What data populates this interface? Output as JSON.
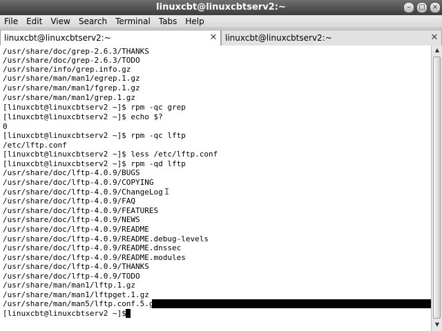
{
  "window": {
    "title": "linuxcbt@linuxcbtserv2:~",
    "minimize_glyph": "–",
    "maximize_glyph": "□",
    "close_glyph": "×"
  },
  "menu": [
    "File",
    "Edit",
    "View",
    "Search",
    "Terminal",
    "Tabs",
    "Help"
  ],
  "tabs": [
    {
      "label": "linuxcbt@linuxcbtserv2:~",
      "active": true,
      "close_icon": "close-icon"
    },
    {
      "label": "linuxcbt@linuxcbtserv2:~",
      "active": false,
      "close_icon": "close-icon"
    }
  ],
  "terminal": {
    "lines": [
      "/usr/share/doc/grep-2.6.3/THANKS",
      "/usr/share/doc/grep-2.6.3/TODO",
      "/usr/share/info/grep.info.gz",
      "/usr/share/man/man1/egrep.1.gz",
      "/usr/share/man/man1/fgrep.1.gz",
      "/usr/share/man/man1/grep.1.gz",
      "[linuxcbt@linuxcbtserv2 ~]$ rpm -qc grep",
      "[linuxcbt@linuxcbtserv2 ~]$ echo $?",
      "0",
      "[linuxcbt@linuxcbtserv2 ~]$ rpm -qc lftp",
      "/etc/lftp.conf",
      "[linuxcbt@linuxcbtserv2 ~]$ less /etc/lftp.conf",
      "[linuxcbt@linuxcbtserv2 ~]$ rpm -qd lftp",
      "/usr/share/doc/lftp-4.0.9/BUGS",
      "/usr/share/doc/lftp-4.0.9/COPYING",
      "/usr/share/doc/lftp-4.0.9/ChangeLog",
      "/usr/share/doc/lftp-4.0.9/FAQ",
      "/usr/share/doc/lftp-4.0.9/FEATURES",
      "/usr/share/doc/lftp-4.0.9/NEWS",
      "/usr/share/doc/lftp-4.0.9/README",
      "/usr/share/doc/lftp-4.0.9/README.debug-levels",
      "/usr/share/doc/lftp-4.0.9/README.dnssec",
      "/usr/share/doc/lftp-4.0.9/README.modules",
      "/usr/share/doc/lftp-4.0.9/THANKS",
      "/usr/share/doc/lftp-4.0.9/TODO",
      "/usr/share/man/man1/lftp.1.gz",
      "/usr/share/man/man1/lftpget.1.gz",
      "/usr/share/man/man5/lftp.conf.5.gz",
      "[linuxcbt@linuxcbtserv2 ~]$ "
    ],
    "foreground": "#000000",
    "background": "#ffffff"
  },
  "icons": {
    "text_cursor": "ibeam-cursor-icon",
    "scroll_up": "arrow-up-icon",
    "scroll_down": "arrow-down-icon"
  }
}
